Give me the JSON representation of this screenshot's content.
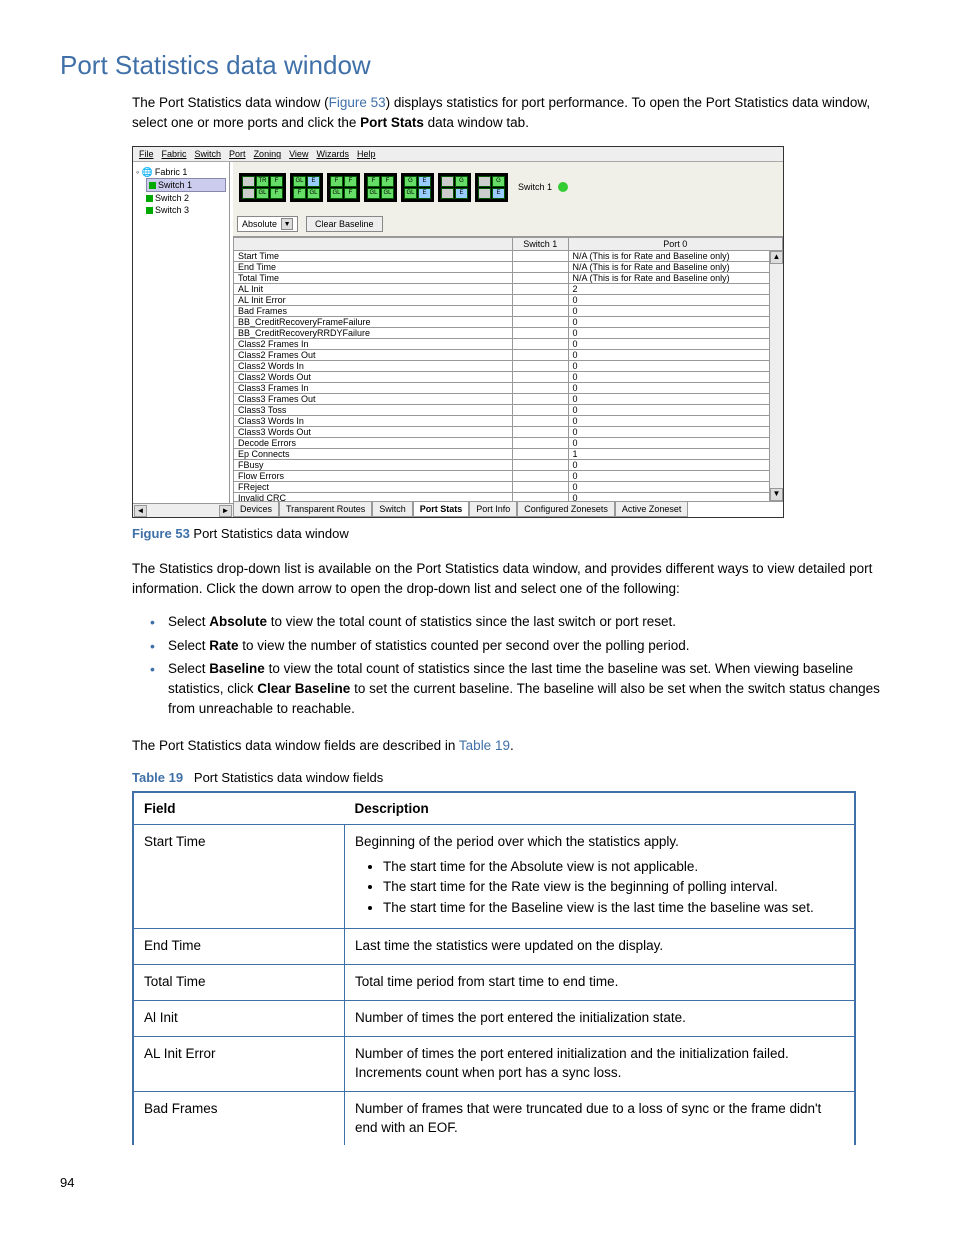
{
  "heading": "Port Statistics data window",
  "intro_a": "The Port Statistics data window (",
  "intro_link": "Figure 53",
  "intro_b": ") displays statistics for port performance. To open the Port Statistics data window, select one or more ports and click the ",
  "intro_bold": "Port Stats",
  "intro_c": " data window tab.",
  "screenshot": {
    "menu": [
      "File",
      "Fabric",
      "Switch",
      "Port",
      "Zoning",
      "View",
      "Wizards",
      "Help"
    ],
    "tree": {
      "root": "Fabric 1",
      "items": [
        "Switch 1",
        "Switch 2",
        "Switch 3"
      ]
    },
    "switch_label": "Switch 1",
    "dropdown": "Absolute",
    "clear_btn": "Clear Baseline",
    "headers": [
      "",
      "Switch 1",
      "Port 0"
    ],
    "rows": [
      [
        "Start Time",
        "",
        "N/A (This is for Rate and Baseline only)"
      ],
      [
        "End Time",
        "",
        "N/A (This is for Rate and Baseline only)"
      ],
      [
        "Total Time",
        "",
        "N/A (This is for Rate and Baseline only)"
      ],
      [
        "AL Init",
        "",
        "2"
      ],
      [
        "AL Init Error",
        "",
        "0"
      ],
      [
        "Bad Frames",
        "",
        "0"
      ],
      [
        "BB_CreditRecoveryFrameFailure",
        "",
        "0"
      ],
      [
        "BB_CreditRecoveryRRDYFailure",
        "",
        "0"
      ],
      [
        "Class2 Frames In",
        "",
        "0"
      ],
      [
        "Class2 Frames Out",
        "",
        "0"
      ],
      [
        "Class2 Words In",
        "",
        "0"
      ],
      [
        "Class2 Words Out",
        "",
        "0"
      ],
      [
        "Class3 Frames In",
        "",
        "0"
      ],
      [
        "Class3 Frames Out",
        "",
        "0"
      ],
      [
        "Class3 Toss",
        "",
        "0"
      ],
      [
        "Class3 Words In",
        "",
        "0"
      ],
      [
        "Class3 Words Out",
        "",
        "0"
      ],
      [
        "Decode Errors",
        "",
        "0"
      ],
      [
        "Ep Connects",
        "",
        "1"
      ],
      [
        "FBusy",
        "",
        "0"
      ],
      [
        "Flow Errors",
        "",
        "0"
      ],
      [
        "FReject",
        "",
        "0"
      ],
      [
        "Invalid CRC",
        "",
        "0"
      ]
    ],
    "tabs": [
      "Devices",
      "Transparent Routes",
      "Switch",
      "Port Stats",
      "Port Info",
      "Configured Zonesets",
      "Active Zoneset"
    ]
  },
  "fig53": {
    "label": "Figure 53",
    "text": " Port Statistics data window"
  },
  "para2": "The Statistics drop-down list is available on the Port Statistics data window, and provides different ways to view detailed port information. Click the down arrow to open the drop-down list and select one of the following:",
  "opts": [
    {
      "pre": "Select ",
      "b": "Absolute",
      "post": " to view the total count of statistics since the last switch or port reset."
    },
    {
      "pre": "Select ",
      "b": "Rate",
      "post": " to view the number of statistics counted per second over the polling period."
    },
    {
      "pre": "Select ",
      "b": "Baseline",
      "post": " to view the total count of statistics since the last time the baseline was set. When viewing baseline statistics, click ",
      "b2": "Clear Baseline",
      "post2": " to set the current baseline. The baseline will also be set when the switch status changes from unreachable to reachable."
    }
  ],
  "para3_a": "The Port Statistics data window fields are described in ",
  "para3_link": "Table 19",
  "para3_b": ".",
  "tab19": {
    "label": "Table 19",
    "text": "Port Statistics data window fields"
  },
  "fieldtab": {
    "header": [
      "Field",
      "Description"
    ],
    "rows": [
      {
        "f": "Start Time",
        "d": "Beginning of the period over which the statistics apply.",
        "bullets": [
          "The start time for the Absolute view is not applicable.",
          "The start time for the Rate view is the beginning of polling interval.",
          "The start time for the Baseline view is the last time the baseline was set."
        ]
      },
      {
        "f": "End Time",
        "d": "Last time the statistics were updated on the display."
      },
      {
        "f": "Total Time",
        "d": "Total time period from start time to end time."
      },
      {
        "f": "Al Init",
        "d": "Number of times the port entered the initialization state."
      },
      {
        "f": "AL Init Error",
        "d": "Number of times the port entered initialization and the initialization failed. Increments count when port has a sync loss."
      },
      {
        "f": "Bad Frames",
        "d": "Number of frames that were truncated due to a loss of sync or the frame didn't end with an EOF."
      }
    ]
  },
  "pagenum": "94"
}
